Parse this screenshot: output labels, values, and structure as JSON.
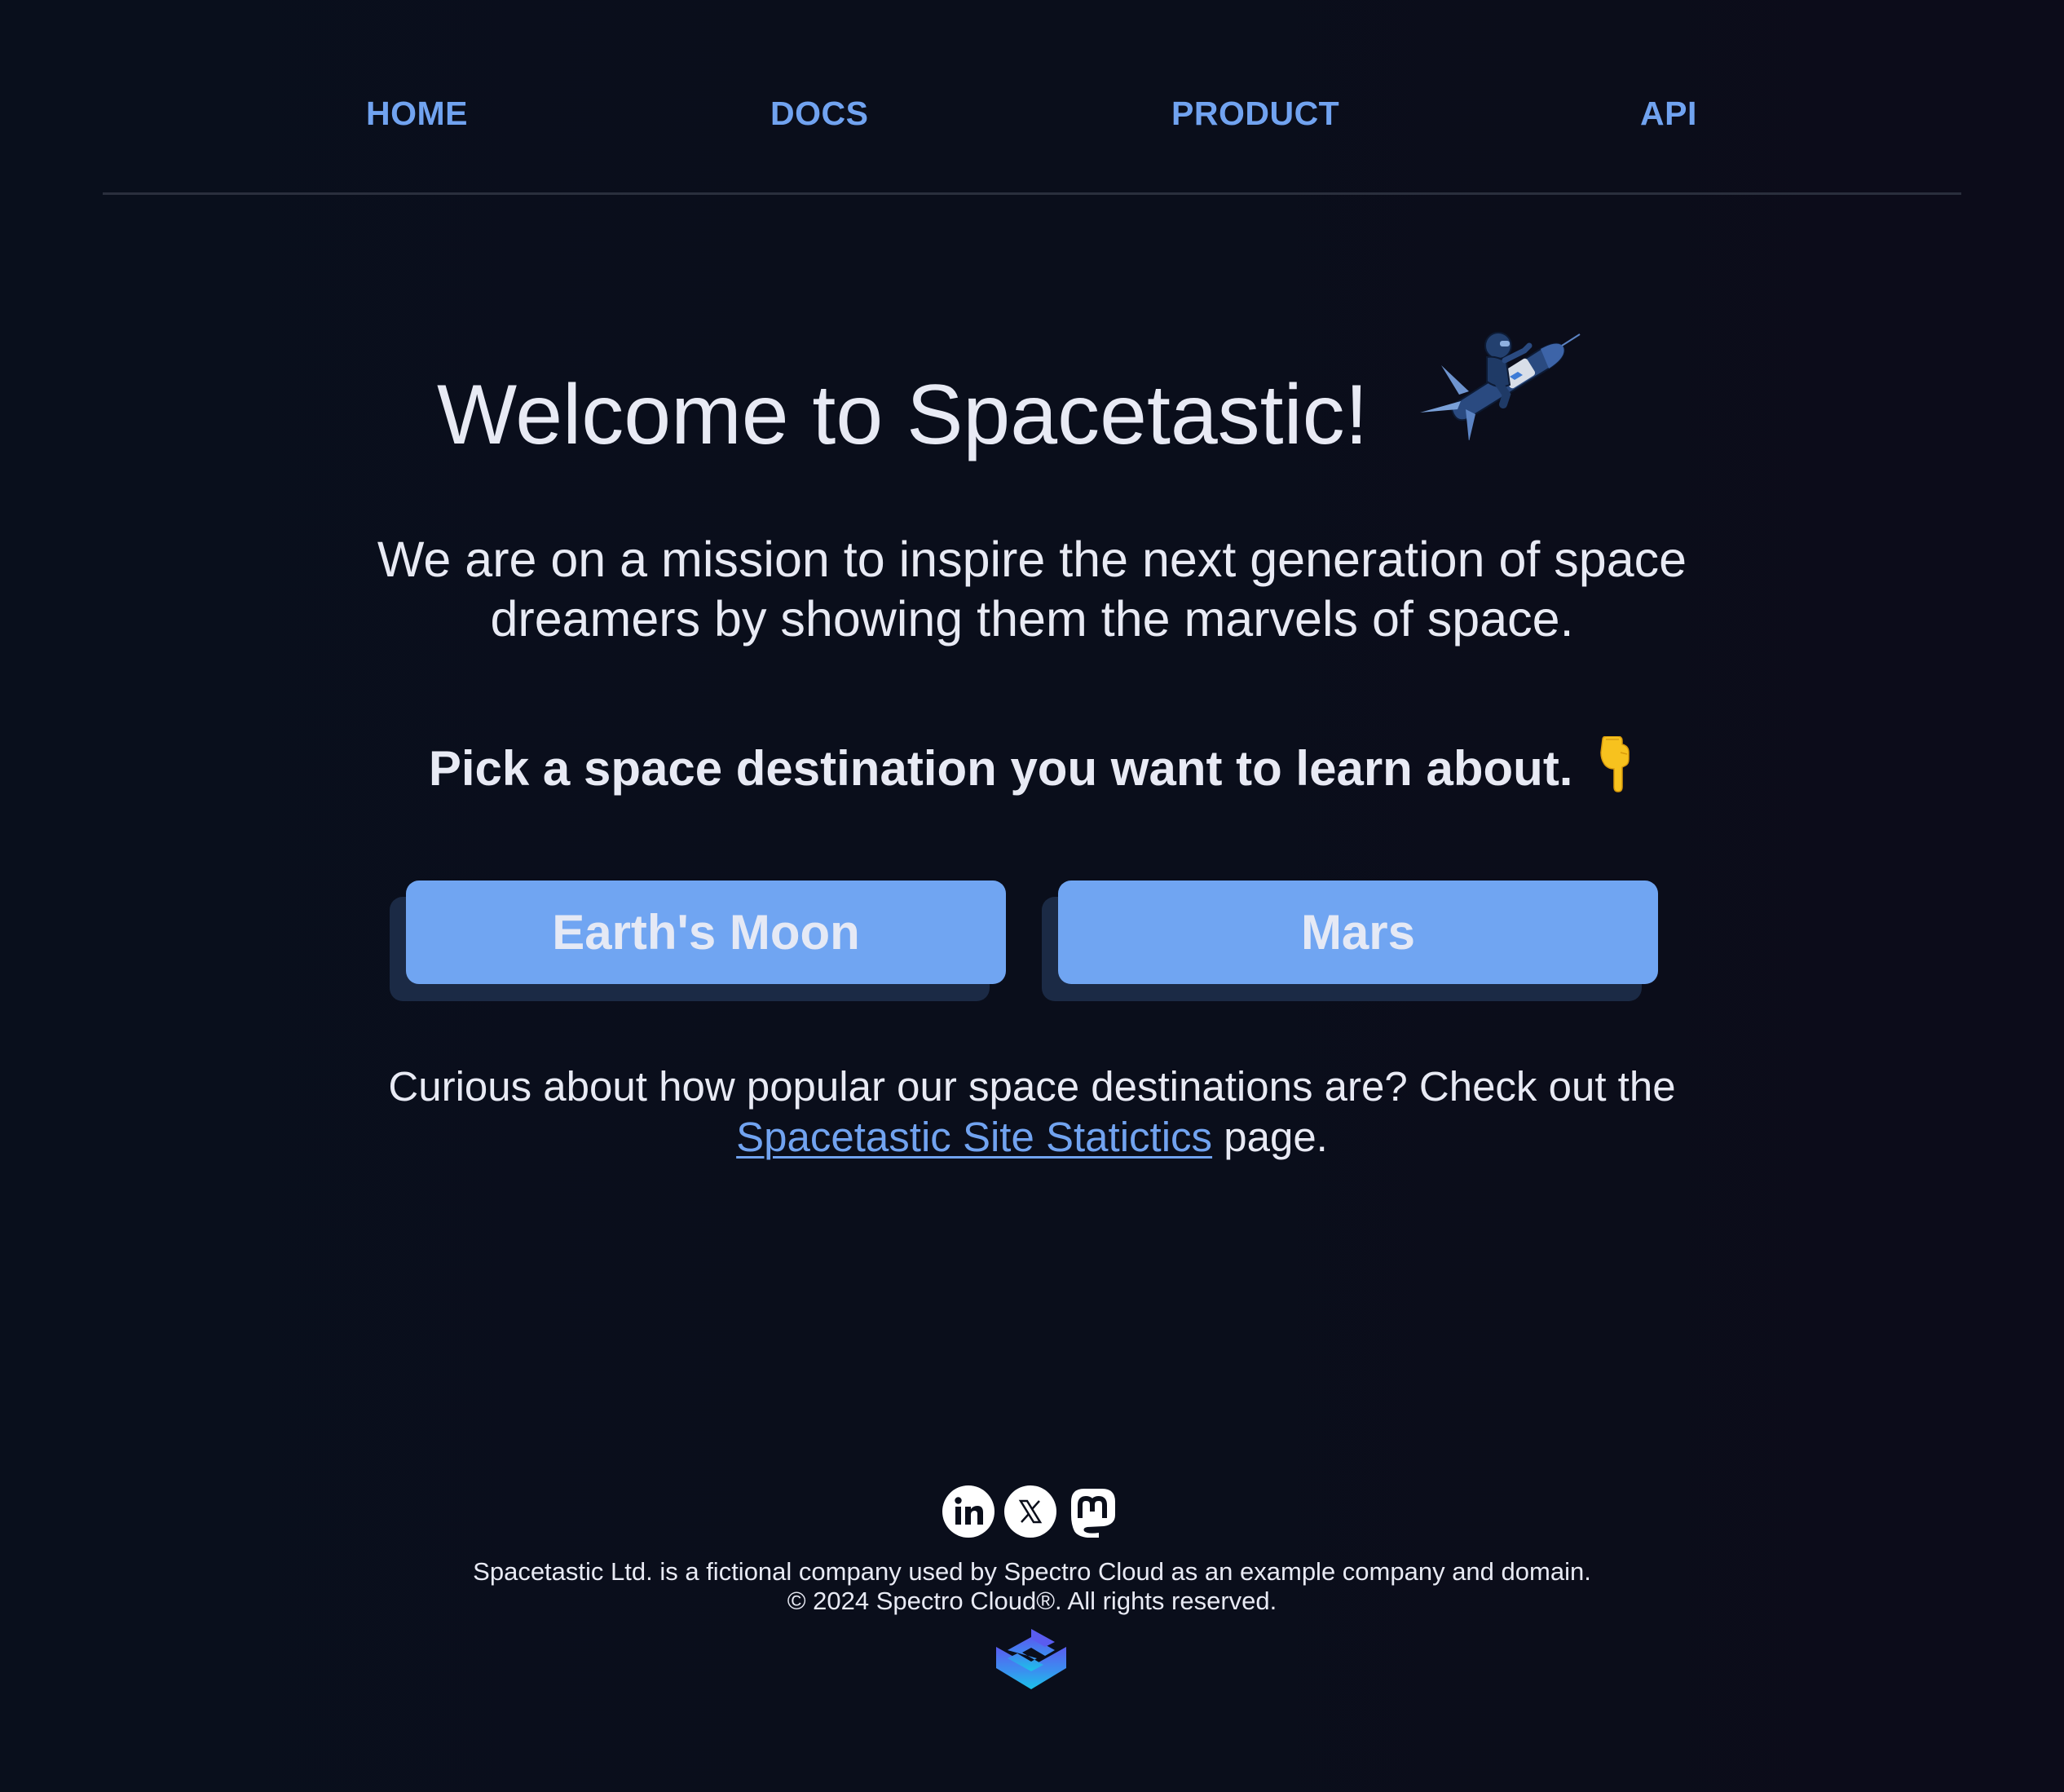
{
  "nav": {
    "items": [
      {
        "label": "HOME"
      },
      {
        "label": "DOCS"
      },
      {
        "label": "PRODUCT"
      },
      {
        "label": "API"
      }
    ]
  },
  "hero": {
    "title": "Welcome to Spacetastic!",
    "image_icon": "astronaut-riding-rocket-icon",
    "mission": "We are on a mission to inspire the next generation of space dreamers by showing them the marvels of space."
  },
  "destinations": {
    "prompt": "Pick a space destination you want to learn about.",
    "prompt_emoji": "👇",
    "buttons": [
      {
        "label": "Earth's Moon"
      },
      {
        "label": "Mars"
      }
    ]
  },
  "stats": {
    "text_before": "Curious about how popular our space destinations are? Check out the",
    "link_label": " Spacetastic Site Statictics",
    "text_after": " page."
  },
  "footer": {
    "social": [
      {
        "name": "linkedin-icon"
      },
      {
        "name": "x-icon"
      },
      {
        "name": "mastodon-icon"
      }
    ],
    "disclaimer": "Spacetastic Ltd. is a fictional company used by Spectro Cloud as an example company and domain.",
    "copyright": "© 2024 Spectro Cloud®. All rights reserved.",
    "logo_icon": "spectro-cloud-logo-icon"
  },
  "colors": {
    "background": "#0a0e1a",
    "accent": "#71a3f0",
    "button": "#70a5f2",
    "button_shadow": "#1b2a45",
    "text": "#e8eaf4"
  }
}
